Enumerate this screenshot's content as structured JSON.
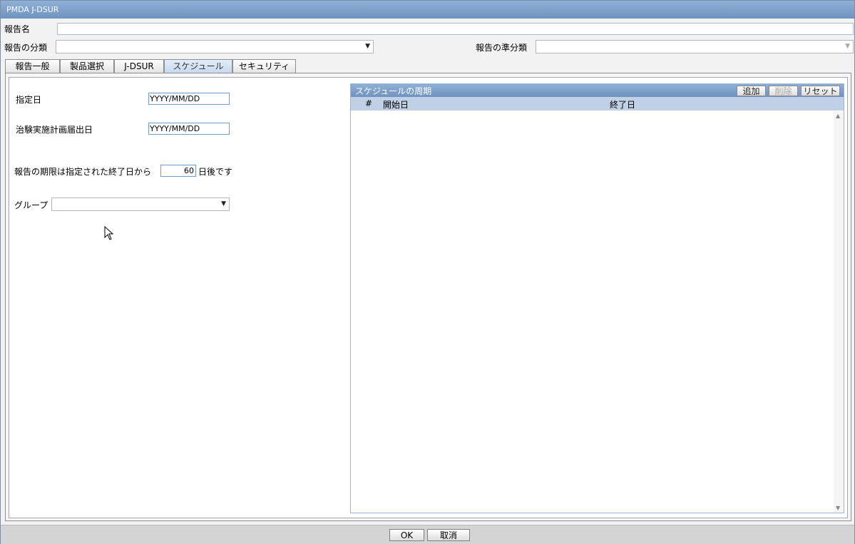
{
  "window": {
    "title": "PMDA J-DSUR"
  },
  "form": {
    "report_name_label": "報告名",
    "report_name_value": "",
    "report_category_label": "報告の分類",
    "report_category_value": "",
    "report_subcategory_label": "報告の準分類",
    "report_subcategory_value": ""
  },
  "tabs": [
    {
      "label": "報告一般"
    },
    {
      "label": "製品選択"
    },
    {
      "label": "J-DSUR"
    },
    {
      "label": "スケジュール",
      "active": true
    },
    {
      "label": "セキュリティ"
    }
  ],
  "schedule": {
    "designated_date_label": "指定日",
    "designated_date_value": "YYYY/MM/DD",
    "notification_date_label": "治験実施計画届出日",
    "notification_date_value": "YYYY/MM/DD",
    "deadline_prefix": "報告の期限は指定された終了日から",
    "deadline_days": "60",
    "deadline_suffix": "日後です",
    "group_label": "グループ",
    "group_value": ""
  },
  "period_panel": {
    "title": "スケジュールの周期",
    "add_label": "追加",
    "delete_label": "削除",
    "reset_label": "リセット",
    "columns": [
      "#",
      "開始日",
      "終了日"
    ],
    "rows": []
  },
  "footer": {
    "ok_label": "OK",
    "cancel_label": "取消"
  },
  "icons": {
    "dropdown": "chevron-down-icon",
    "pointer": "mouse-pointer-icon"
  },
  "colors": {
    "title_bar": "#7a9cc8",
    "input_border": "#6f9bd1",
    "column_header": "#c0d0e6"
  }
}
